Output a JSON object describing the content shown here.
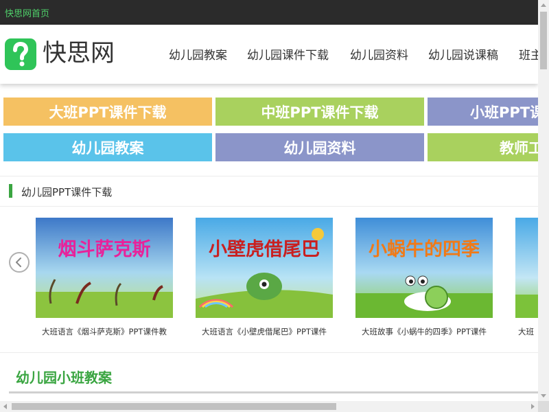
{
  "topbar": {
    "home_link": "快思网首页"
  },
  "header": {
    "logo_text": "快思网",
    "logo_symbol": "?",
    "nav": [
      "幼儿园教案",
      "幼儿园课件下载",
      "幼儿园资料",
      "幼儿园说课稿",
      "班主"
    ]
  },
  "banners": {
    "row1": [
      "大班PPT课件下载",
      "中班PPT课件下载",
      "小班PPT课"
    ],
    "row2": [
      "幼儿园教案",
      "幼儿园资料",
      "教师工"
    ]
  },
  "section": {
    "title": "幼儿园PPT课件下载",
    "items": [
      {
        "thumb_title": "烟斗萨克斯",
        "caption": "大班语言《烟斗萨克斯》PPT课件教"
      },
      {
        "thumb_title": "小壁虎借尾巴",
        "caption": "大班语言《小壁虎借尾巴》PPT课件"
      },
      {
        "thumb_title": "小蜗牛的四季",
        "caption": "大班故事《小蜗牛的四季》PPT课件"
      },
      {
        "thumb_title": "",
        "caption": "大班"
      }
    ]
  },
  "next_section": {
    "title": "幼儿园小班教案"
  },
  "icons": {
    "carousel_prev": "chevron-left-icon",
    "logo": "question-mark-icon"
  },
  "colors": {
    "brand_green": "#2fc458",
    "banner_orange": "#f5c162",
    "banner_green": "#a9d15e",
    "banner_purple": "#8b95c9",
    "banner_blue": "#5ac3ea",
    "heading_green": "#3aa541"
  }
}
